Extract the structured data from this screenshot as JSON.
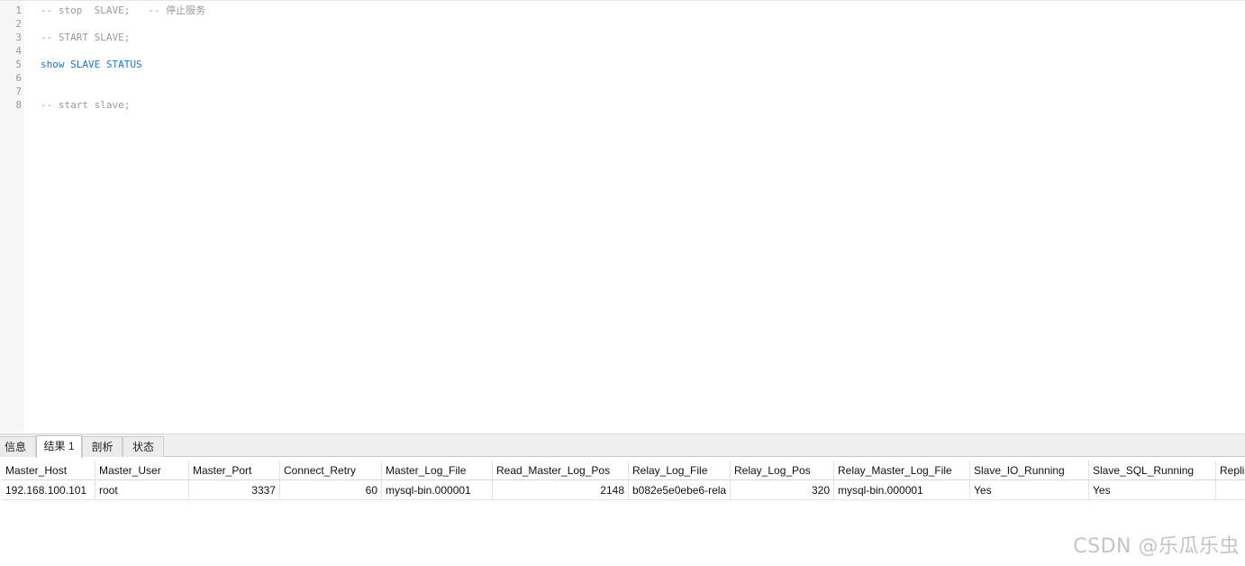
{
  "editor": {
    "lines": [
      {
        "no": "1",
        "text": "-- stop  SLAVE;   -- 停止服务",
        "kind": "comment"
      },
      {
        "no": "2",
        "text": "",
        "kind": "plain"
      },
      {
        "no": "3",
        "text": "-- START SLAVE;",
        "kind": "comment"
      },
      {
        "no": "4",
        "text": "",
        "kind": "plain"
      },
      {
        "no": "5",
        "text": "show SLAVE STATUS",
        "kind": "keyword"
      },
      {
        "no": "6",
        "text": "",
        "kind": "plain"
      },
      {
        "no": "7",
        "text": "",
        "kind": "plain"
      },
      {
        "no": "8",
        "text": "-- start slave;",
        "kind": "comment"
      }
    ]
  },
  "tabs": [
    {
      "label": "信息",
      "active": false
    },
    {
      "label": "结果 1",
      "active": true
    },
    {
      "label": "剖析",
      "active": false
    },
    {
      "label": "状态",
      "active": false
    }
  ],
  "results": {
    "columns": [
      "Master_Host",
      "Master_User",
      "Master_Port",
      "Connect_Retry",
      "Master_Log_File",
      "Read_Master_Log_Pos",
      "Relay_Log_File",
      "Relay_Log_Pos",
      "Relay_Master_Log_File",
      "Slave_IO_Running",
      "Slave_SQL_Running",
      "Repli"
    ],
    "rows": [
      [
        "192.168.100.101",
        "root",
        "3337",
        "60",
        "mysql-bin.000001",
        "2148",
        "b082e5e0ebe6-rela",
        "320",
        "mysql-bin.000001",
        "Yes",
        "Yes",
        ""
      ]
    ]
  },
  "watermark": "CSDN @乐瓜乐虫",
  "colors": {
    "comment": "#9a9a9a",
    "keyword": "#1a72d8"
  }
}
